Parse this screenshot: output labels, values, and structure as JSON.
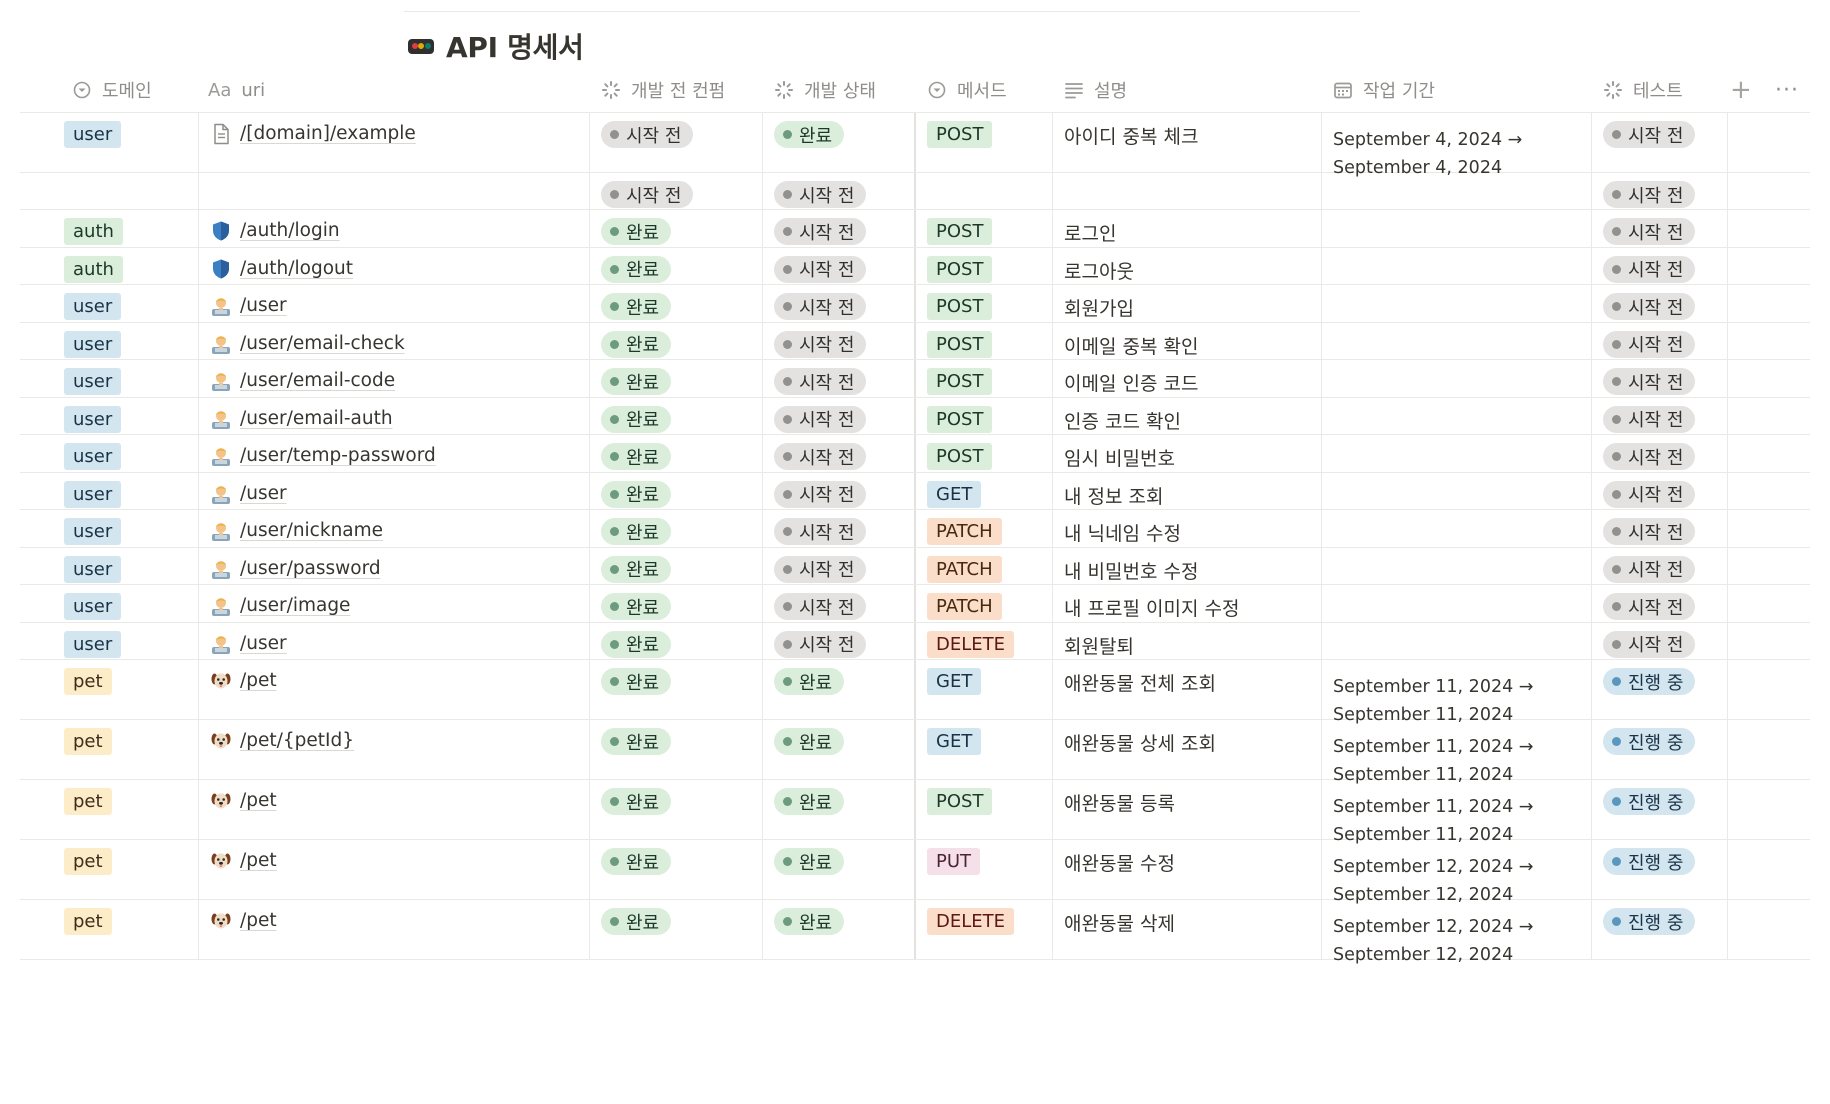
{
  "page": {
    "title": "API 명세서",
    "title_icon": "traffic-light-icon",
    "icon_colors": [
      "#e03e3e",
      "#dfab01",
      "#0f7b6c"
    ]
  },
  "columns": [
    {
      "key": "domain",
      "label": "도메인",
      "icon": "select-icon"
    },
    {
      "key": "uri",
      "label": "uri",
      "icon": "title-aa-icon"
    },
    {
      "key": "pre_confirm",
      "label": "개발 전 컨펌",
      "icon": "status-icon"
    },
    {
      "key": "dev_status",
      "label": "개발 상태",
      "icon": "status-icon"
    },
    {
      "key": "method",
      "label": "메서드",
      "icon": "select-icon"
    },
    {
      "key": "desc",
      "label": "설명",
      "icon": "text-lines-icon"
    },
    {
      "key": "period",
      "label": "작업 기간",
      "icon": "calendar-icon"
    },
    {
      "key": "test",
      "label": "테스트",
      "icon": "status-icon"
    }
  ],
  "header_actions": {
    "add": "+",
    "more": "···"
  },
  "rows": [
    {
      "domain": "user",
      "icon": "page",
      "uri": "/[domain]/example",
      "pre": "시작 전",
      "dev": "완료",
      "method": "POST",
      "desc": "아이디 중복 체크",
      "period_start": "September 4, 2024 →",
      "period_end": "September 4, 2024",
      "test": "시작 전"
    },
    {
      "domain": "",
      "icon": "",
      "uri": "",
      "pre": "시작 전",
      "dev": "시작 전",
      "method": "",
      "desc": "",
      "period_start": "",
      "period_end": "",
      "test": "시작 전"
    },
    {
      "domain": "auth",
      "icon": "shield",
      "uri": "/auth/login",
      "pre": "완료",
      "dev": "시작 전",
      "method": "POST",
      "desc": "로그인",
      "period_start": "",
      "period_end": "",
      "test": "시작 전"
    },
    {
      "domain": "auth",
      "icon": "shield",
      "uri": "/auth/logout",
      "pre": "완료",
      "dev": "시작 전",
      "method": "POST",
      "desc": "로그아웃",
      "period_start": "",
      "period_end": "",
      "test": "시작 전"
    },
    {
      "domain": "user",
      "icon": "person",
      "uri": "/user",
      "pre": "완료",
      "dev": "시작 전",
      "method": "POST",
      "desc": "회원가입",
      "period_start": "",
      "period_end": "",
      "test": "시작 전"
    },
    {
      "domain": "user",
      "icon": "person",
      "uri": "/user/email-check",
      "pre": "완료",
      "dev": "시작 전",
      "method": "POST",
      "desc": "이메일 중복 확인",
      "period_start": "",
      "period_end": "",
      "test": "시작 전"
    },
    {
      "domain": "user",
      "icon": "person",
      "uri": "/user/email-code",
      "pre": "완료",
      "dev": "시작 전",
      "method": "POST",
      "desc": "이메일 인증 코드",
      "period_start": "",
      "period_end": "",
      "test": "시작 전"
    },
    {
      "domain": "user",
      "icon": "person",
      "uri": "/user/email-auth",
      "pre": "완료",
      "dev": "시작 전",
      "method": "POST",
      "desc": "인증 코드 확인",
      "period_start": "",
      "period_end": "",
      "test": "시작 전"
    },
    {
      "domain": "user",
      "icon": "person",
      "uri": "/user/temp-password",
      "pre": "완료",
      "dev": "시작 전",
      "method": "POST",
      "desc": "임시 비밀번호",
      "period_start": "",
      "period_end": "",
      "test": "시작 전"
    },
    {
      "domain": "user",
      "icon": "person",
      "uri": "/user",
      "pre": "완료",
      "dev": "시작 전",
      "method": "GET",
      "desc": "내 정보 조회",
      "period_start": "",
      "period_end": "",
      "test": "시작 전"
    },
    {
      "domain": "user",
      "icon": "person",
      "uri": "/user/nickname",
      "pre": "완료",
      "dev": "시작 전",
      "method": "PATCH",
      "desc": "내 닉네임 수정",
      "period_start": "",
      "period_end": "",
      "test": "시작 전"
    },
    {
      "domain": "user",
      "icon": "person",
      "uri": "/user/password",
      "pre": "완료",
      "dev": "시작 전",
      "method": "PATCH",
      "desc": "내 비밀번호 수정",
      "period_start": "",
      "period_end": "",
      "test": "시작 전"
    },
    {
      "domain": "user",
      "icon": "person",
      "uri": " /user/image",
      "pre": "완료",
      "dev": "시작 전",
      "method": "PATCH",
      "desc": "내 프로필 이미지 수정",
      "period_start": "",
      "period_end": "",
      "test": "시작 전"
    },
    {
      "domain": "user",
      "icon": "person",
      "uri": "/user",
      "pre": "완료",
      "dev": "시작 전",
      "method": "DELETE",
      "desc": "회원탈퇴",
      "period_start": "",
      "period_end": "",
      "test": "시작 전"
    },
    {
      "domain": "pet",
      "icon": "dog",
      "uri": "/pet",
      "pre": "완료",
      "dev": "완료",
      "method": "GET",
      "desc": "애완동물 전체 조회",
      "period_start": "September 11, 2024 →",
      "period_end": "September 11, 2024",
      "test": "진행 중"
    },
    {
      "domain": "pet",
      "icon": "dog",
      "uri": "/pet/{petId}",
      "pre": "완료",
      "dev": "완료",
      "method": "GET",
      "desc": "애완동물 상세 조회",
      "period_start": "September 11, 2024 →",
      "period_end": "September 11, 2024",
      "test": "진행 중"
    },
    {
      "domain": "pet",
      "icon": "dog",
      "uri": "/pet",
      "pre": "완료",
      "dev": "완료",
      "method": "POST",
      "desc": "애완동물 등록",
      "period_start": "September 11, 2024 →",
      "period_end": "September 11, 2024",
      "test": "진행 중"
    },
    {
      "domain": "pet",
      "icon": "dog",
      "uri": "/pet",
      "pre": "완료",
      "dev": "완료",
      "method": "PUT",
      "desc": "애완동물 수정",
      "period_start": "September 12, 2024 →",
      "period_end": "September 12, 2024",
      "test": "진행 중"
    },
    {
      "domain": "pet",
      "icon": "dog",
      "uri": "/pet",
      "pre": "완료",
      "dev": "완료",
      "method": "DELETE",
      "desc": "애완동물 삭제",
      "period_start": "September 12, 2024 →",
      "period_end": "September 12, 2024",
      "test": "진행 중"
    }
  ]
}
